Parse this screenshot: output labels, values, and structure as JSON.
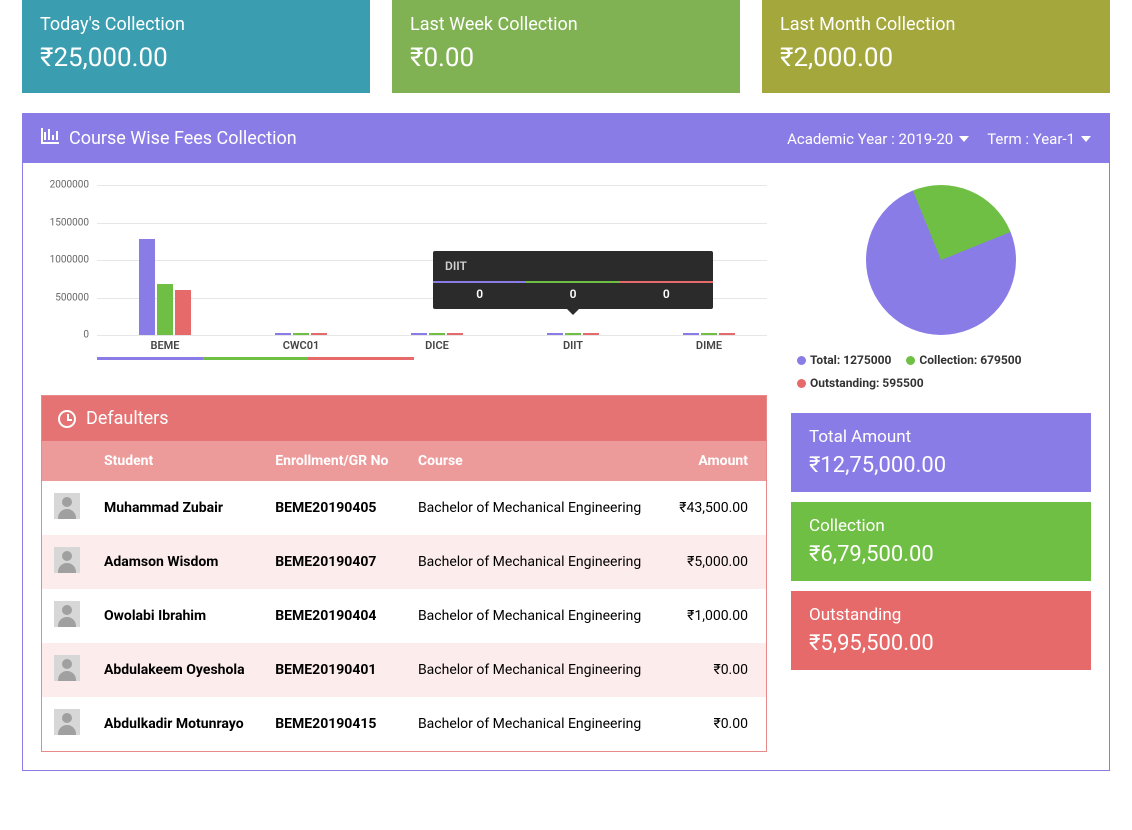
{
  "top_cards": [
    {
      "label": "Today's Collection",
      "value": "₹25,000.00",
      "color": "#3a9db0"
    },
    {
      "label": "Last Week Collection",
      "value": "₹0.00",
      "color": "#80b253"
    },
    {
      "label": "Last Month Collection",
      "value": "₹2,000.00",
      "color": "#a3a73c"
    }
  ],
  "panel": {
    "title": "Course Wise Fees Collection",
    "academic_year_label": "Academic Year : 2019-20",
    "term_label": "Term : Year-1"
  },
  "chart_data": {
    "type": "bar",
    "categories": [
      "BEME",
      "CWC01",
      "DICE",
      "DIIT",
      "DIME"
    ],
    "series": [
      {
        "name": "Total",
        "color": "#8a7ce6",
        "values": [
          1275000,
          0,
          0,
          0,
          0
        ]
      },
      {
        "name": "Collection",
        "color": "#6fbf44",
        "values": [
          679500,
          0,
          0,
          0,
          0
        ]
      },
      {
        "name": "Outstanding",
        "color": "#e66a6a",
        "values": [
          595500,
          0,
          0,
          0,
          0
        ]
      }
    ],
    "y_ticks": [
      0,
      500000,
      1000000,
      1500000,
      2000000
    ],
    "ylim": [
      0,
      2000000
    ],
    "tooltip": {
      "category": "DIIT",
      "values": [
        "0",
        "0",
        "0"
      ]
    }
  },
  "pie_data": {
    "type": "pie",
    "slices": [
      {
        "label": "Total",
        "value": 1275000,
        "color": "#8a7ce6"
      },
      {
        "label": "Collection",
        "value": 679500,
        "color": "#6fbf44"
      },
      {
        "label": "Outstanding",
        "value": 595500,
        "color": "#e66a6a"
      }
    ]
  },
  "pie_legend": [
    {
      "color": "#8a7ce6",
      "text": "Total: 1275000"
    },
    {
      "color": "#6fbf44",
      "text": "Collection: 679500"
    },
    {
      "color": "#e66a6a",
      "text": "Outstanding: 595500"
    }
  ],
  "defaulters": {
    "title": "Defaulters",
    "columns": [
      "",
      "Student",
      "Enrollment/GR No",
      "Course",
      "Amount"
    ],
    "rows": [
      {
        "student": "Muhammad Zubair",
        "enroll": "BEME20190405",
        "course": "Bachelor of Mechanical Engineering",
        "amount": "₹43,500.00"
      },
      {
        "student": "Adamson Wisdom",
        "enroll": "BEME20190407",
        "course": "Bachelor of Mechanical Engineering",
        "amount": "₹5,000.00"
      },
      {
        "student": "Owolabi Ibrahim",
        "enroll": "BEME20190404",
        "course": "Bachelor of Mechanical Engineering",
        "amount": "₹1,000.00"
      },
      {
        "student": "Abdulakeem Oyeshola",
        "enroll": "BEME20190401",
        "course": "Bachelor of Mechanical Engineering",
        "amount": "₹0.00"
      },
      {
        "student": "Abdulkadir Motunrayo",
        "enroll": "BEME20190415",
        "course": "Bachelor of Mechanical Engineering",
        "amount": "₹0.00"
      }
    ]
  },
  "side_boxes": [
    {
      "label": "Total Amount",
      "value": "₹12,75,000.00",
      "color": "#8a7ce6"
    },
    {
      "label": "Collection",
      "value": "₹6,79,500.00",
      "color": "#6fbf44"
    },
    {
      "label": "Outstanding",
      "value": "₹5,95,500.00",
      "color": "#e66a6a"
    }
  ]
}
